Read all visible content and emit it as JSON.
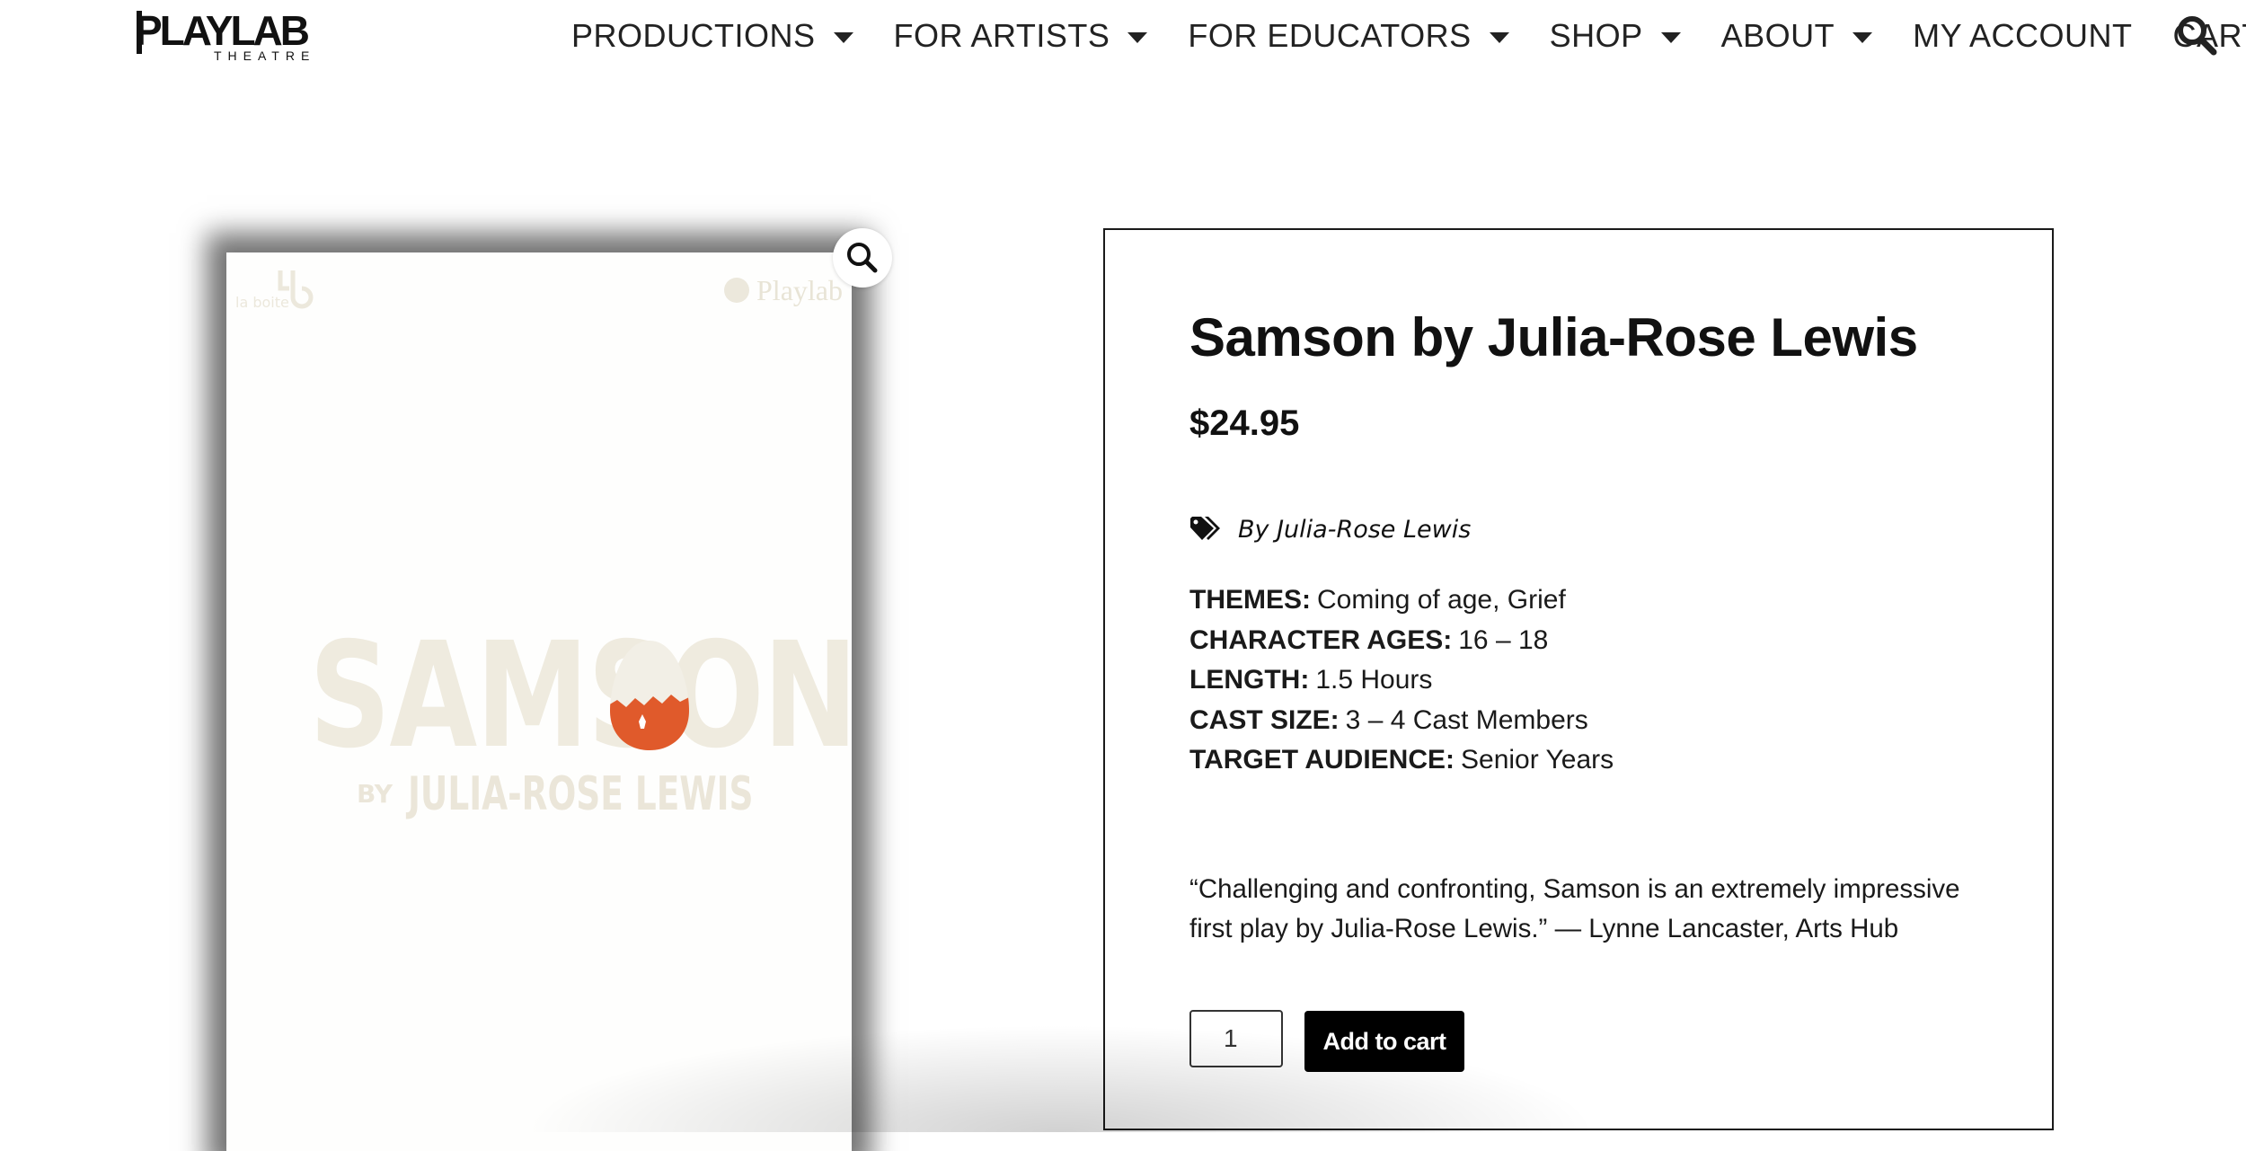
{
  "header": {
    "logo_text": "PLAYLAB",
    "logo_subtext": "THEATRE",
    "nav": [
      {
        "label": "PRODUCTIONS",
        "has_dropdown": true
      },
      {
        "label": "FOR ARTISTS",
        "has_dropdown": true
      },
      {
        "label": "FOR EDUCATORS",
        "has_dropdown": true
      },
      {
        "label": "SHOP",
        "has_dropdown": true
      },
      {
        "label": "ABOUT",
        "has_dropdown": true
      },
      {
        "label": "MY ACCOUNT",
        "has_dropdown": false
      },
      {
        "label": "CART",
        "has_dropdown": false
      }
    ],
    "search_icon": "search-icon"
  },
  "product_image": {
    "cover_title": "SAMSON",
    "cover_by": "BY",
    "cover_author": "JULIA-ROSE LEWIS",
    "cover_logo_left": "la boite",
    "cover_logo_right": "Playlab",
    "zoom_icon": "magnifier-icon",
    "colors": {
      "cover_text": "#efebdf",
      "egg_accent": "#e05a2b"
    }
  },
  "product": {
    "title": "Samson by Julia-Rose Lewis",
    "price": "$24.95",
    "tag_icon": "tags-icon",
    "tag_label": "By Julia-Rose Lewis",
    "details": [
      {
        "label": "THEMES:",
        "value": "Coming of age, Grief"
      },
      {
        "label": "CHARACTER AGES:",
        "value": "16 – 18"
      },
      {
        "label": "LENGTH:",
        "value": "1.5 Hours"
      },
      {
        "label": "CAST SIZE:",
        "value": "3 – 4 Cast Members"
      },
      {
        "label": "TARGET AUDIENCE:",
        "value": "Senior Years"
      }
    ],
    "quote": "“Challenging and confronting, Samson is an extremely impressive first play by Julia-Rose Lewis.” — Lynne Lancaster, Arts Hub",
    "quantity": "1",
    "add_to_cart_label": "Add to cart"
  }
}
